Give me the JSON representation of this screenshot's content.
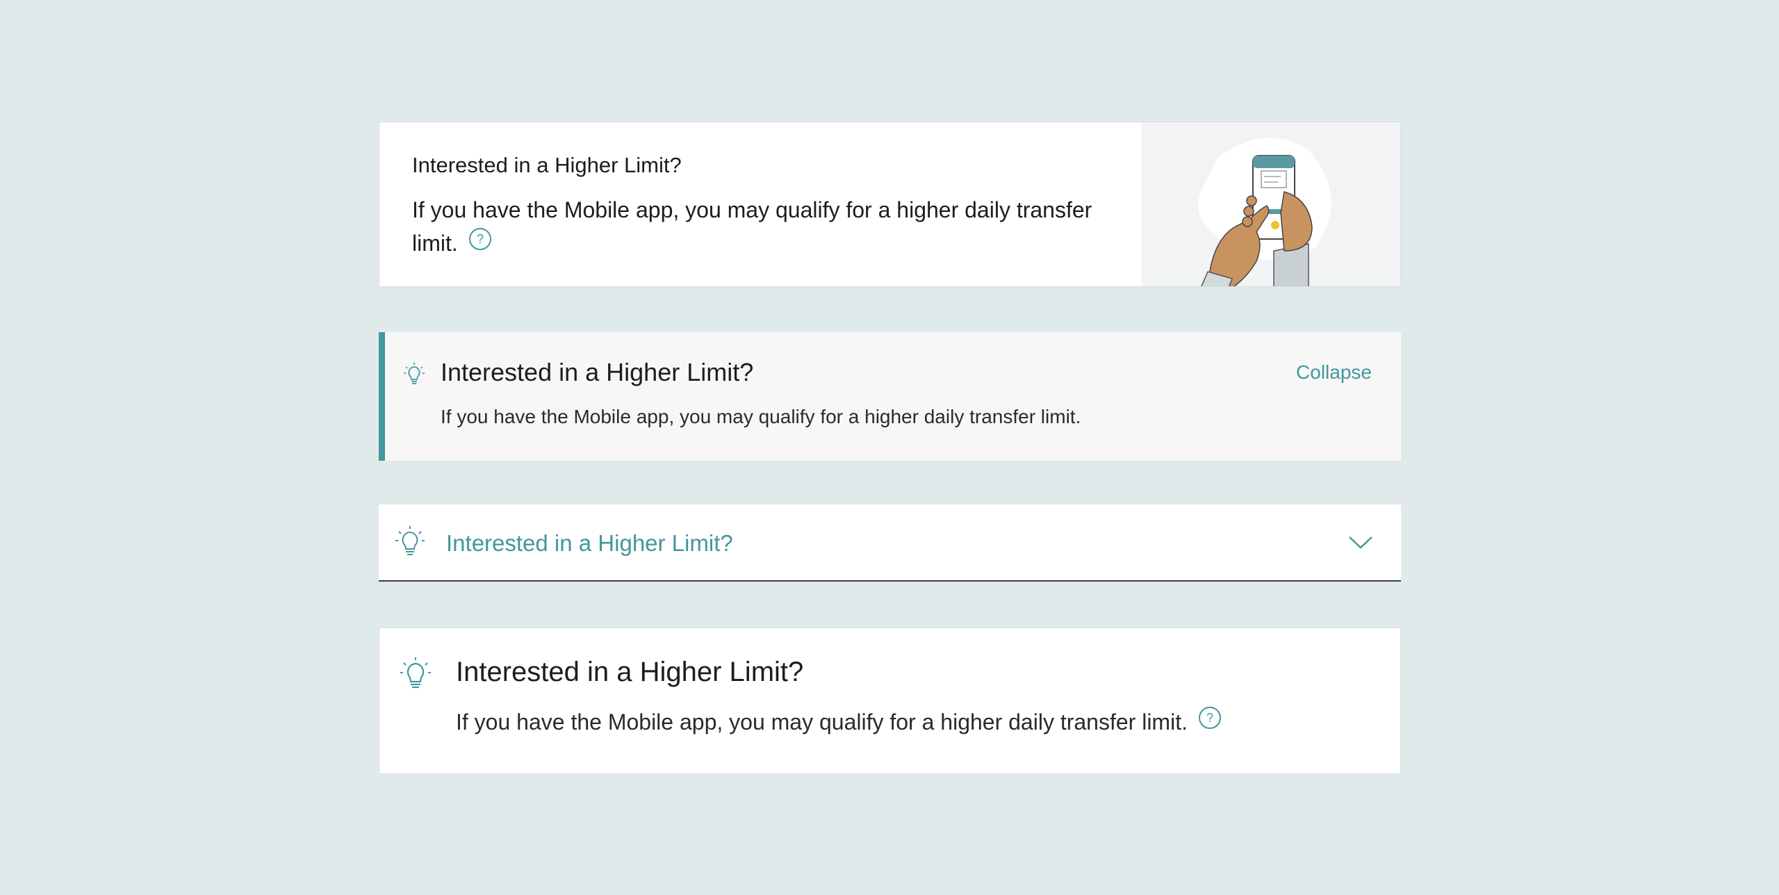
{
  "colors": {
    "accent": "#43979e",
    "background": "#e1eaeb",
    "text": "#1d1d1d"
  },
  "card1": {
    "title": "Interested in a Higher Limit?",
    "body": "If you have the Mobile app, you may qualify for a higher daily transfer limit.",
    "help_icon": "question-circle-icon",
    "illustration": "hand-holding-phone-illustration"
  },
  "card2": {
    "icon": "lightbulb-icon",
    "title": "Interested in a Higher Limit?",
    "body": "If you have the Mobile app, you may qualify for a higher daily transfer limit.",
    "collapse_label": "Collapse"
  },
  "card3": {
    "icon": "lightbulb-icon",
    "title": "Interested in a Higher Limit?",
    "toggle_icon": "chevron-down-icon"
  },
  "card4": {
    "icon": "lightbulb-icon",
    "title": "Interested in a Higher Limit?",
    "body": "If you have the Mobile app, you may qualify for a higher daily transfer limit.",
    "help_icon": "question-circle-icon"
  }
}
